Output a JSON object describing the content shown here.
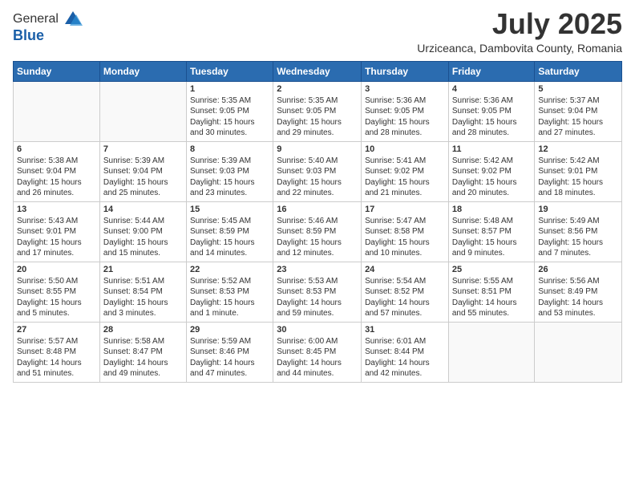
{
  "logo": {
    "general": "General",
    "blue": "Blue"
  },
  "header": {
    "month": "July 2025",
    "location": "Urziceanca, Dambovita County, Romania"
  },
  "weekdays": [
    "Sunday",
    "Monday",
    "Tuesday",
    "Wednesday",
    "Thursday",
    "Friday",
    "Saturday"
  ],
  "weeks": [
    [
      {
        "day": "",
        "info": ""
      },
      {
        "day": "",
        "info": ""
      },
      {
        "day": "1",
        "info": "Sunrise: 5:35 AM\nSunset: 9:05 PM\nDaylight: 15 hours\nand 30 minutes."
      },
      {
        "day": "2",
        "info": "Sunrise: 5:35 AM\nSunset: 9:05 PM\nDaylight: 15 hours\nand 29 minutes."
      },
      {
        "day": "3",
        "info": "Sunrise: 5:36 AM\nSunset: 9:05 PM\nDaylight: 15 hours\nand 28 minutes."
      },
      {
        "day": "4",
        "info": "Sunrise: 5:36 AM\nSunset: 9:05 PM\nDaylight: 15 hours\nand 28 minutes."
      },
      {
        "day": "5",
        "info": "Sunrise: 5:37 AM\nSunset: 9:04 PM\nDaylight: 15 hours\nand 27 minutes."
      }
    ],
    [
      {
        "day": "6",
        "info": "Sunrise: 5:38 AM\nSunset: 9:04 PM\nDaylight: 15 hours\nand 26 minutes."
      },
      {
        "day": "7",
        "info": "Sunrise: 5:39 AM\nSunset: 9:04 PM\nDaylight: 15 hours\nand 25 minutes."
      },
      {
        "day": "8",
        "info": "Sunrise: 5:39 AM\nSunset: 9:03 PM\nDaylight: 15 hours\nand 23 minutes."
      },
      {
        "day": "9",
        "info": "Sunrise: 5:40 AM\nSunset: 9:03 PM\nDaylight: 15 hours\nand 22 minutes."
      },
      {
        "day": "10",
        "info": "Sunrise: 5:41 AM\nSunset: 9:02 PM\nDaylight: 15 hours\nand 21 minutes."
      },
      {
        "day": "11",
        "info": "Sunrise: 5:42 AM\nSunset: 9:02 PM\nDaylight: 15 hours\nand 20 minutes."
      },
      {
        "day": "12",
        "info": "Sunrise: 5:42 AM\nSunset: 9:01 PM\nDaylight: 15 hours\nand 18 minutes."
      }
    ],
    [
      {
        "day": "13",
        "info": "Sunrise: 5:43 AM\nSunset: 9:01 PM\nDaylight: 15 hours\nand 17 minutes."
      },
      {
        "day": "14",
        "info": "Sunrise: 5:44 AM\nSunset: 9:00 PM\nDaylight: 15 hours\nand 15 minutes."
      },
      {
        "day": "15",
        "info": "Sunrise: 5:45 AM\nSunset: 8:59 PM\nDaylight: 15 hours\nand 14 minutes."
      },
      {
        "day": "16",
        "info": "Sunrise: 5:46 AM\nSunset: 8:59 PM\nDaylight: 15 hours\nand 12 minutes."
      },
      {
        "day": "17",
        "info": "Sunrise: 5:47 AM\nSunset: 8:58 PM\nDaylight: 15 hours\nand 10 minutes."
      },
      {
        "day": "18",
        "info": "Sunrise: 5:48 AM\nSunset: 8:57 PM\nDaylight: 15 hours\nand 9 minutes."
      },
      {
        "day": "19",
        "info": "Sunrise: 5:49 AM\nSunset: 8:56 PM\nDaylight: 15 hours\nand 7 minutes."
      }
    ],
    [
      {
        "day": "20",
        "info": "Sunrise: 5:50 AM\nSunset: 8:55 PM\nDaylight: 15 hours\nand 5 minutes."
      },
      {
        "day": "21",
        "info": "Sunrise: 5:51 AM\nSunset: 8:54 PM\nDaylight: 15 hours\nand 3 minutes."
      },
      {
        "day": "22",
        "info": "Sunrise: 5:52 AM\nSunset: 8:53 PM\nDaylight: 15 hours\nand 1 minute."
      },
      {
        "day": "23",
        "info": "Sunrise: 5:53 AM\nSunset: 8:53 PM\nDaylight: 14 hours\nand 59 minutes."
      },
      {
        "day": "24",
        "info": "Sunrise: 5:54 AM\nSunset: 8:52 PM\nDaylight: 14 hours\nand 57 minutes."
      },
      {
        "day": "25",
        "info": "Sunrise: 5:55 AM\nSunset: 8:51 PM\nDaylight: 14 hours\nand 55 minutes."
      },
      {
        "day": "26",
        "info": "Sunrise: 5:56 AM\nSunset: 8:49 PM\nDaylight: 14 hours\nand 53 minutes."
      }
    ],
    [
      {
        "day": "27",
        "info": "Sunrise: 5:57 AM\nSunset: 8:48 PM\nDaylight: 14 hours\nand 51 minutes."
      },
      {
        "day": "28",
        "info": "Sunrise: 5:58 AM\nSunset: 8:47 PM\nDaylight: 14 hours\nand 49 minutes."
      },
      {
        "day": "29",
        "info": "Sunrise: 5:59 AM\nSunset: 8:46 PM\nDaylight: 14 hours\nand 47 minutes."
      },
      {
        "day": "30",
        "info": "Sunrise: 6:00 AM\nSunset: 8:45 PM\nDaylight: 14 hours\nand 44 minutes."
      },
      {
        "day": "31",
        "info": "Sunrise: 6:01 AM\nSunset: 8:44 PM\nDaylight: 14 hours\nand 42 minutes."
      },
      {
        "day": "",
        "info": ""
      },
      {
        "day": "",
        "info": ""
      }
    ]
  ]
}
